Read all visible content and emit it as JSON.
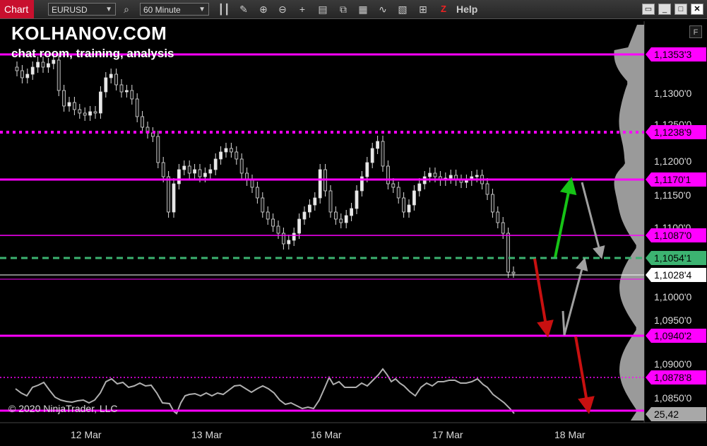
{
  "toolbar": {
    "tab_label": "Chart",
    "instrument": "EURUSD",
    "timeframe": "60 Minute",
    "help_label": "Help",
    "z_label": "Z"
  },
  "chart": {
    "watermark_title": "KOLHANOV.COM",
    "watermark_subtitle": "chat room, training, analysis",
    "copyright": "© 2020 NinjaTrader, LLC",
    "f_button": "F",
    "x_labels": [
      "12 Mar",
      "13 Mar",
      "16 Mar",
      "17 Mar",
      "18 Mar"
    ],
    "axis_ticks": [
      "1,1300'0",
      "1,1250'0",
      "1,1200'0",
      "1,1150'0",
      "1,1100'0",
      "1,1000'0",
      "1,0950'0",
      "1,0900'0",
      "1,0850'0"
    ],
    "levels": [
      {
        "label": "1,1353'3",
        "color": "#ff00ff",
        "style": "solid"
      },
      {
        "label": "1,1238'9",
        "color": "#ff00ff",
        "style": "dotted"
      },
      {
        "label": "1,1170'1",
        "color": "#ff00ff",
        "style": "solid"
      },
      {
        "label": "1,1087'0",
        "color": "#ff00ff",
        "style": "thin"
      },
      {
        "label": "1,1054'1",
        "color": "#3cb371",
        "style": "dashed"
      },
      {
        "label": "1,1028'4",
        "color": "#ffffff",
        "style": "current"
      },
      {
        "label": "1,0940'2",
        "color": "#ff00ff",
        "style": "solid"
      },
      {
        "label": "1,0878'8",
        "color": "#ff00ff",
        "style": "dotted-thin"
      }
    ],
    "indicator_value": "25,42",
    "colors": {
      "magenta": "#ff00ff",
      "green_level": "#3cb371",
      "arrow_green": "#16c316",
      "arrow_red": "#c81010",
      "arrow_gray": "#a0a0a0"
    }
  }
}
